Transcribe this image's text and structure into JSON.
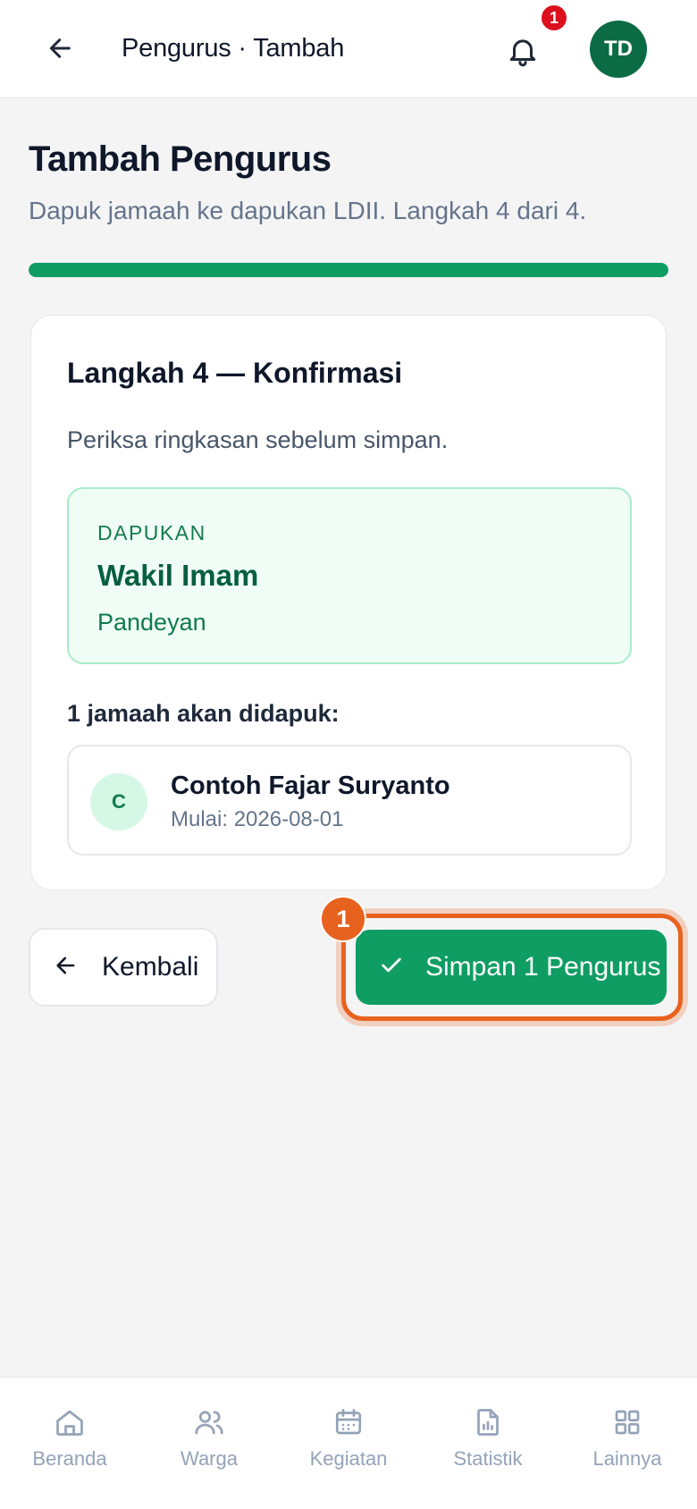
{
  "header": {
    "title": "Pengurus · Tambah",
    "notification_count": "1",
    "avatar_initials": "TD"
  },
  "page": {
    "title": "Tambah Pengurus",
    "subtitle": "Dapuk jamaah ke dapukan LDII. Langkah 4 dari 4.",
    "progress_fraction": 1.0
  },
  "card": {
    "step_title": "Langkah 4 — Konfirmasi",
    "step_desc": "Periksa ringkasan sebelum simpan.",
    "dapukan": {
      "label": "DAPUKAN",
      "name": "Wakil Imam",
      "place": "Pandeyan"
    },
    "count_label": "1 jamaah akan didapuk:",
    "members": [
      {
        "initial": "C",
        "name": "Contoh Fajar Suryanto",
        "start": "Mulai: 2026-08-01"
      }
    ]
  },
  "actions": {
    "back_label": "Kembali",
    "save_label": "Simpan 1 Pengurus",
    "step_marker": "1"
  },
  "bottom_nav": {
    "items": [
      {
        "label": "Beranda",
        "icon": "home-icon"
      },
      {
        "label": "Warga",
        "icon": "users-icon"
      },
      {
        "label": "Kegiatan",
        "icon": "calendar-icon"
      },
      {
        "label": "Statistik",
        "icon": "report-icon"
      },
      {
        "label": "Lainnya",
        "icon": "grid-icon"
      }
    ]
  },
  "colors": {
    "primary": "#0f9d63",
    "highlight": "#e8621f",
    "badge": "#dc0f1c"
  }
}
